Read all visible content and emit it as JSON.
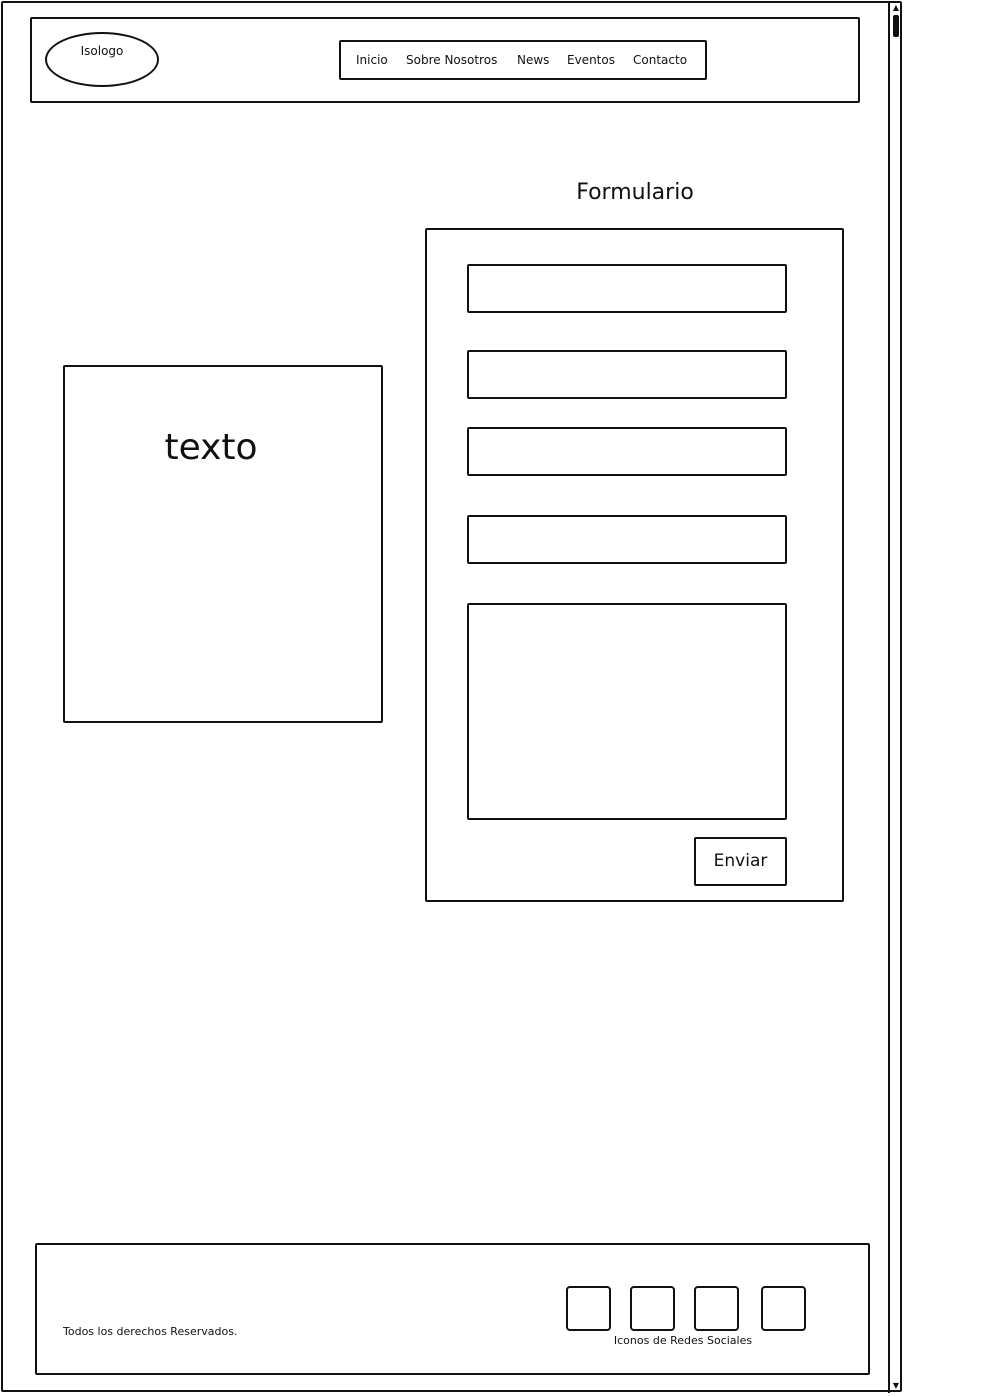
{
  "header": {
    "logo_label": "Isologo",
    "nav": [
      {
        "label": "Inicio"
      },
      {
        "label": "Sobre Nosotros"
      },
      {
        "label": "News"
      },
      {
        "label": "Eventos"
      },
      {
        "label": "Contacto"
      }
    ]
  },
  "main": {
    "text_box_label": "texto",
    "form": {
      "title": "Formulario",
      "submit_label": "Enviar"
    }
  },
  "footer": {
    "rights": "Todos los derechos Reservados.",
    "social_label": "Iconos de Redes Sociales"
  },
  "icons": {
    "scroll_up": "scroll-up-arrow-icon",
    "scroll_down": "scroll-down-arrow-icon"
  }
}
